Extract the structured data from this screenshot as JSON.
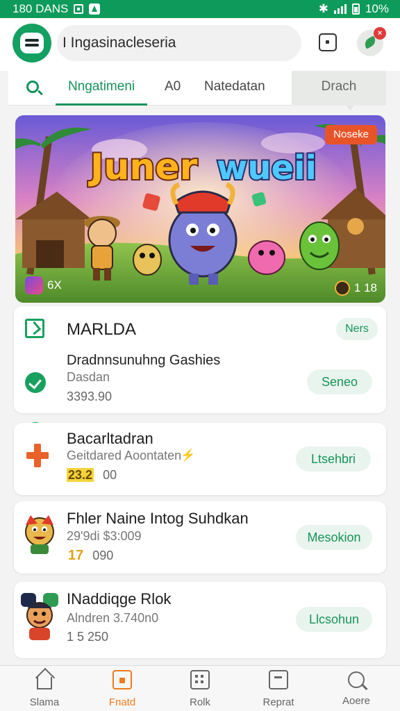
{
  "status_bar": {
    "time": "180 DANS",
    "battery": "10%"
  },
  "header": {
    "search_text": "I Ingasinacleseria",
    "notification_count": "×"
  },
  "tabs": [
    {
      "label": "Nngatimeni"
    },
    {
      "label": "A0"
    },
    {
      "label": "Natedatan"
    },
    {
      "label": "Drach"
    }
  ],
  "banner": {
    "title_line1": "Juner",
    "title_line2": "wueii",
    "badge": "Noseke",
    "left_count": "6X",
    "right_count": "1 18"
  },
  "cards": [
    {
      "title": "MARLDA",
      "tag": "Ners",
      "subtitle": "Dradnnsunuhng Gashies",
      "meta": "Dasdan",
      "value": "3393.90",
      "button": "Seneo"
    },
    {
      "title": "Bacarltadran",
      "meta": "Geitdared Aoontaten",
      "highlight": "23.2",
      "value": "00",
      "button": "Ltsehbri"
    },
    {
      "title": "Fhler Naine Intog Suhdkan",
      "meta": "29'9di $3:009",
      "highlight": "17",
      "value": "090",
      "button": "Mesokion"
    },
    {
      "title": "INaddiqge Rlok",
      "meta": "Alndren 3.740n0",
      "value": "1 5  250",
      "button": "Llcsohun"
    }
  ],
  "bottom_nav": [
    {
      "label": "Slama",
      "icon": "home-icon"
    },
    {
      "label": "Fnatd",
      "icon": "folder-icon",
      "active": true
    },
    {
      "label": "Rolk",
      "icon": "grid-icon"
    },
    {
      "label": "Reprat",
      "icon": "box-icon"
    },
    {
      "label": "Aoere",
      "icon": "search-icon"
    }
  ],
  "colors": {
    "primary": "#0d9a5a",
    "accent": "#ee7a1a",
    "badge": "#e8542a"
  }
}
